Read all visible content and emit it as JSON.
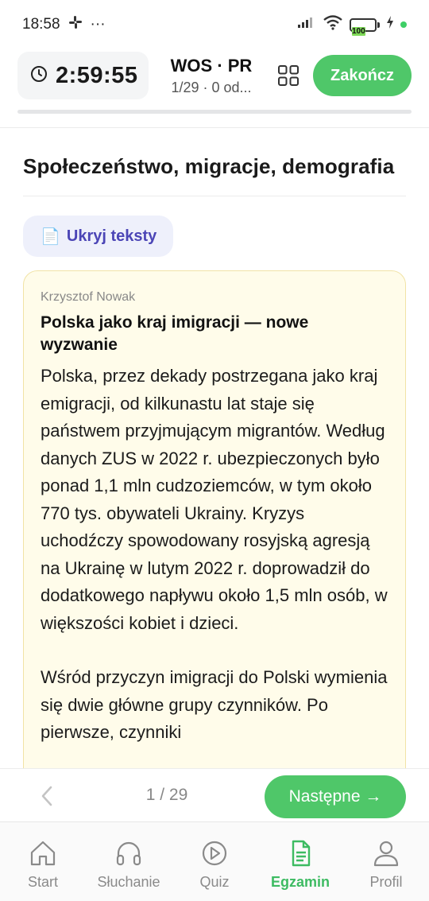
{
  "status_bar": {
    "time": "18:58",
    "more": "···",
    "battery": "100",
    "icons": [
      "slack-icon",
      "signal-icon",
      "wifi-icon",
      "battery-icon",
      "charging-icon"
    ]
  },
  "header": {
    "timer": "2:59:55",
    "exam_title": "WOS · PR",
    "exam_subtitle": "1/29 · 0 od...",
    "finish_label": "Zakończ",
    "progress": 0
  },
  "section": {
    "title": "Społeczeństwo, migracje, demografia",
    "toggle_emoji": "📄",
    "toggle_label": "Ukryj teksty"
  },
  "text_card": {
    "author": "Krzysztof Nowak",
    "title": "Polska jako kraj imigracji — nowe wyzwanie",
    "paragraphs": [
      "Polska, przez dekady postrzegana jako kraj emigracji, od kilkunastu lat staje się państwem przyjmującym migrantów. Według danych ZUS w 2022 r. ubezpieczonych było ponad 1,1 mln cudzoziemców, w tym około 770 tys. obywateli Ukrainy. Kryzys uchodźczy spowodowany rosyjską agresją na Ukrainę w lutym 2022 r. doprowadził do dodatkowego napływu około 1,5 mln osób, w większości kobiet i dzieci.",
      "Wśród przyczyn imigracji do Polski wymienia się dwie główne grupy czynników. Po pierwsze, czynniki"
    ]
  },
  "pager": {
    "count": "1 / 29",
    "next_label": "Następne →"
  },
  "tabbar": {
    "tabs": [
      {
        "label": "Start",
        "icon": "home-icon"
      },
      {
        "label": "Słuchanie",
        "icon": "headphones-icon"
      },
      {
        "label": "Quiz",
        "icon": "play-icon"
      },
      {
        "label": "Egzamin",
        "icon": "document-icon",
        "active": true
      },
      {
        "label": "Profil",
        "icon": "user-icon"
      }
    ]
  },
  "colors": {
    "accent": "#4fc769",
    "toggle_bg": "#eef0fb",
    "toggle_text": "#4b45b6",
    "card_bg": "#fffcea",
    "card_border": "#f1e3a6"
  }
}
